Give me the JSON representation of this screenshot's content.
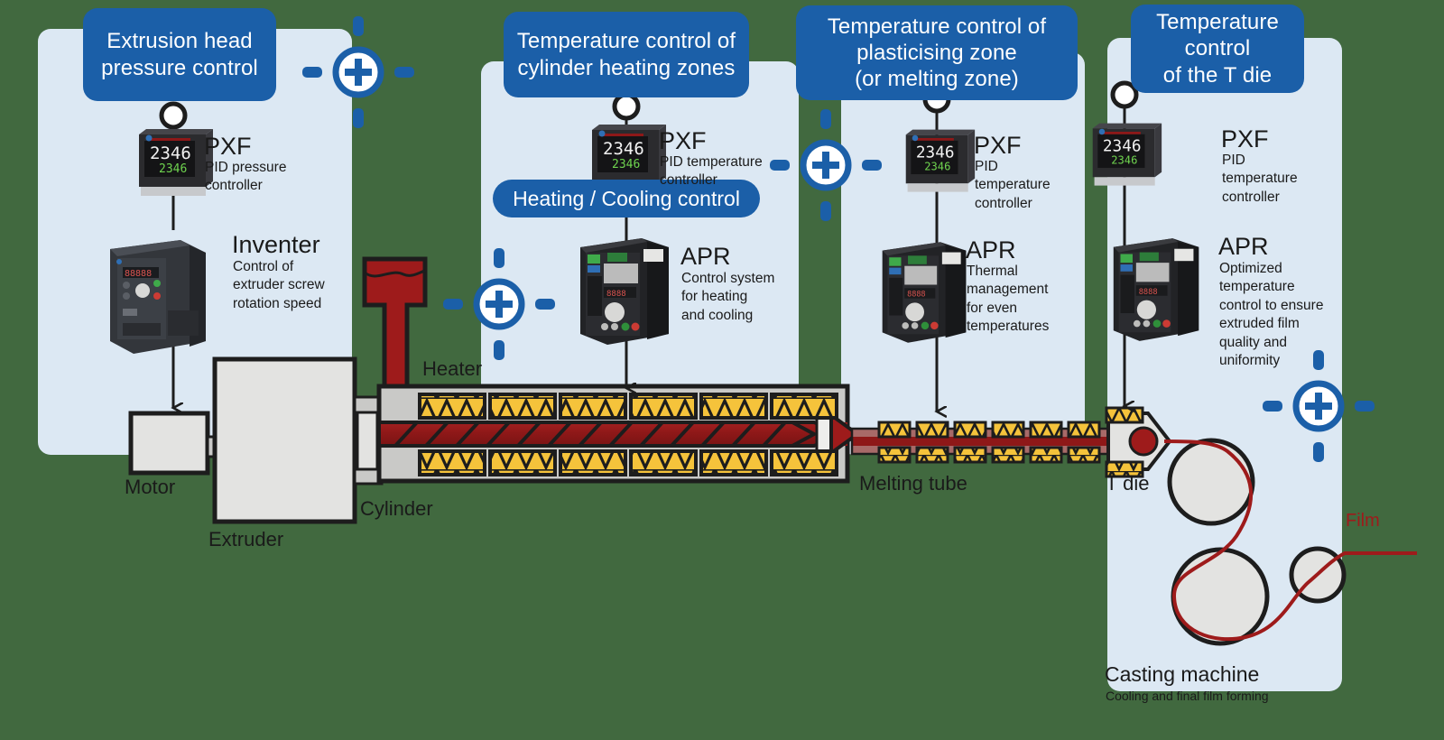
{
  "background_color": "#41693f",
  "panel_color": "#dce8f3",
  "accent_color": "#1b5fa8",
  "melt_color": "#9e1b1b",
  "heater_color": "#f5c33b",
  "callouts": [
    {
      "id": "extrusion-head-pressure",
      "text": "Extrusion head\npressure control"
    },
    {
      "id": "cylinder-heating-zones",
      "text": "Temperature control of\ncylinder heating zones"
    },
    {
      "id": "plasticising-zone",
      "text": "Temperature control of\nplasticising zone\n(or melting zone)"
    },
    {
      "id": "t-die",
      "text": "Temperature\ncontrol\nof the T die"
    }
  ],
  "pill": {
    "label": "Heating / Cooling control"
  },
  "devices": [
    {
      "id": "pxf-pressure",
      "name": "PXF",
      "desc": "PID pressure\ncontroller",
      "display_top": "2346",
      "display_bottom": "2346"
    },
    {
      "id": "inverter",
      "name": "Inventer",
      "desc": "Control of\nextruder screw\nrotation speed",
      "display_top": "88888"
    },
    {
      "id": "pxf-cylinder",
      "name": "PXF",
      "desc": "PID temperature\ncontroller",
      "display_top": "2346",
      "display_bottom": "2346"
    },
    {
      "id": "apr-heating-cooling",
      "name": "APR",
      "desc": "Control system\nfor heating\nand cooling"
    },
    {
      "id": "pxf-plasticising",
      "name": "PXF",
      "desc": "PID\ntemperature\ncontroller",
      "display_top": "2346",
      "display_bottom": "2346"
    },
    {
      "id": "apr-thermal",
      "name": "APR",
      "desc": "Thermal\nmanagement\nfor even\ntemperatures"
    },
    {
      "id": "pxf-tdie",
      "name": "PXF",
      "desc": "PID\ntemperature\ncontroller",
      "display_top": "2346",
      "display_bottom": "2346"
    },
    {
      "id": "apr-optimized",
      "name": "APR",
      "desc": "Optimized\ntemperature\ncontrol to ensure\nextruded film\nquality and\nuniformity"
    }
  ],
  "machine_labels": {
    "motor": "Motor",
    "extruder": "Extruder",
    "cylinder": "Cylinder",
    "heater": "Heater",
    "melting_tube": "Melting tube",
    "t_die": "T die",
    "film": "Film",
    "casting_machine": "Casting machine",
    "casting_machine_sub": "Cooling and final film forming"
  },
  "icons": {
    "plus_marker": "plus-circle-icon",
    "arrow": "down-arrow-icon",
    "connector_dot": "connector-dot-icon"
  }
}
